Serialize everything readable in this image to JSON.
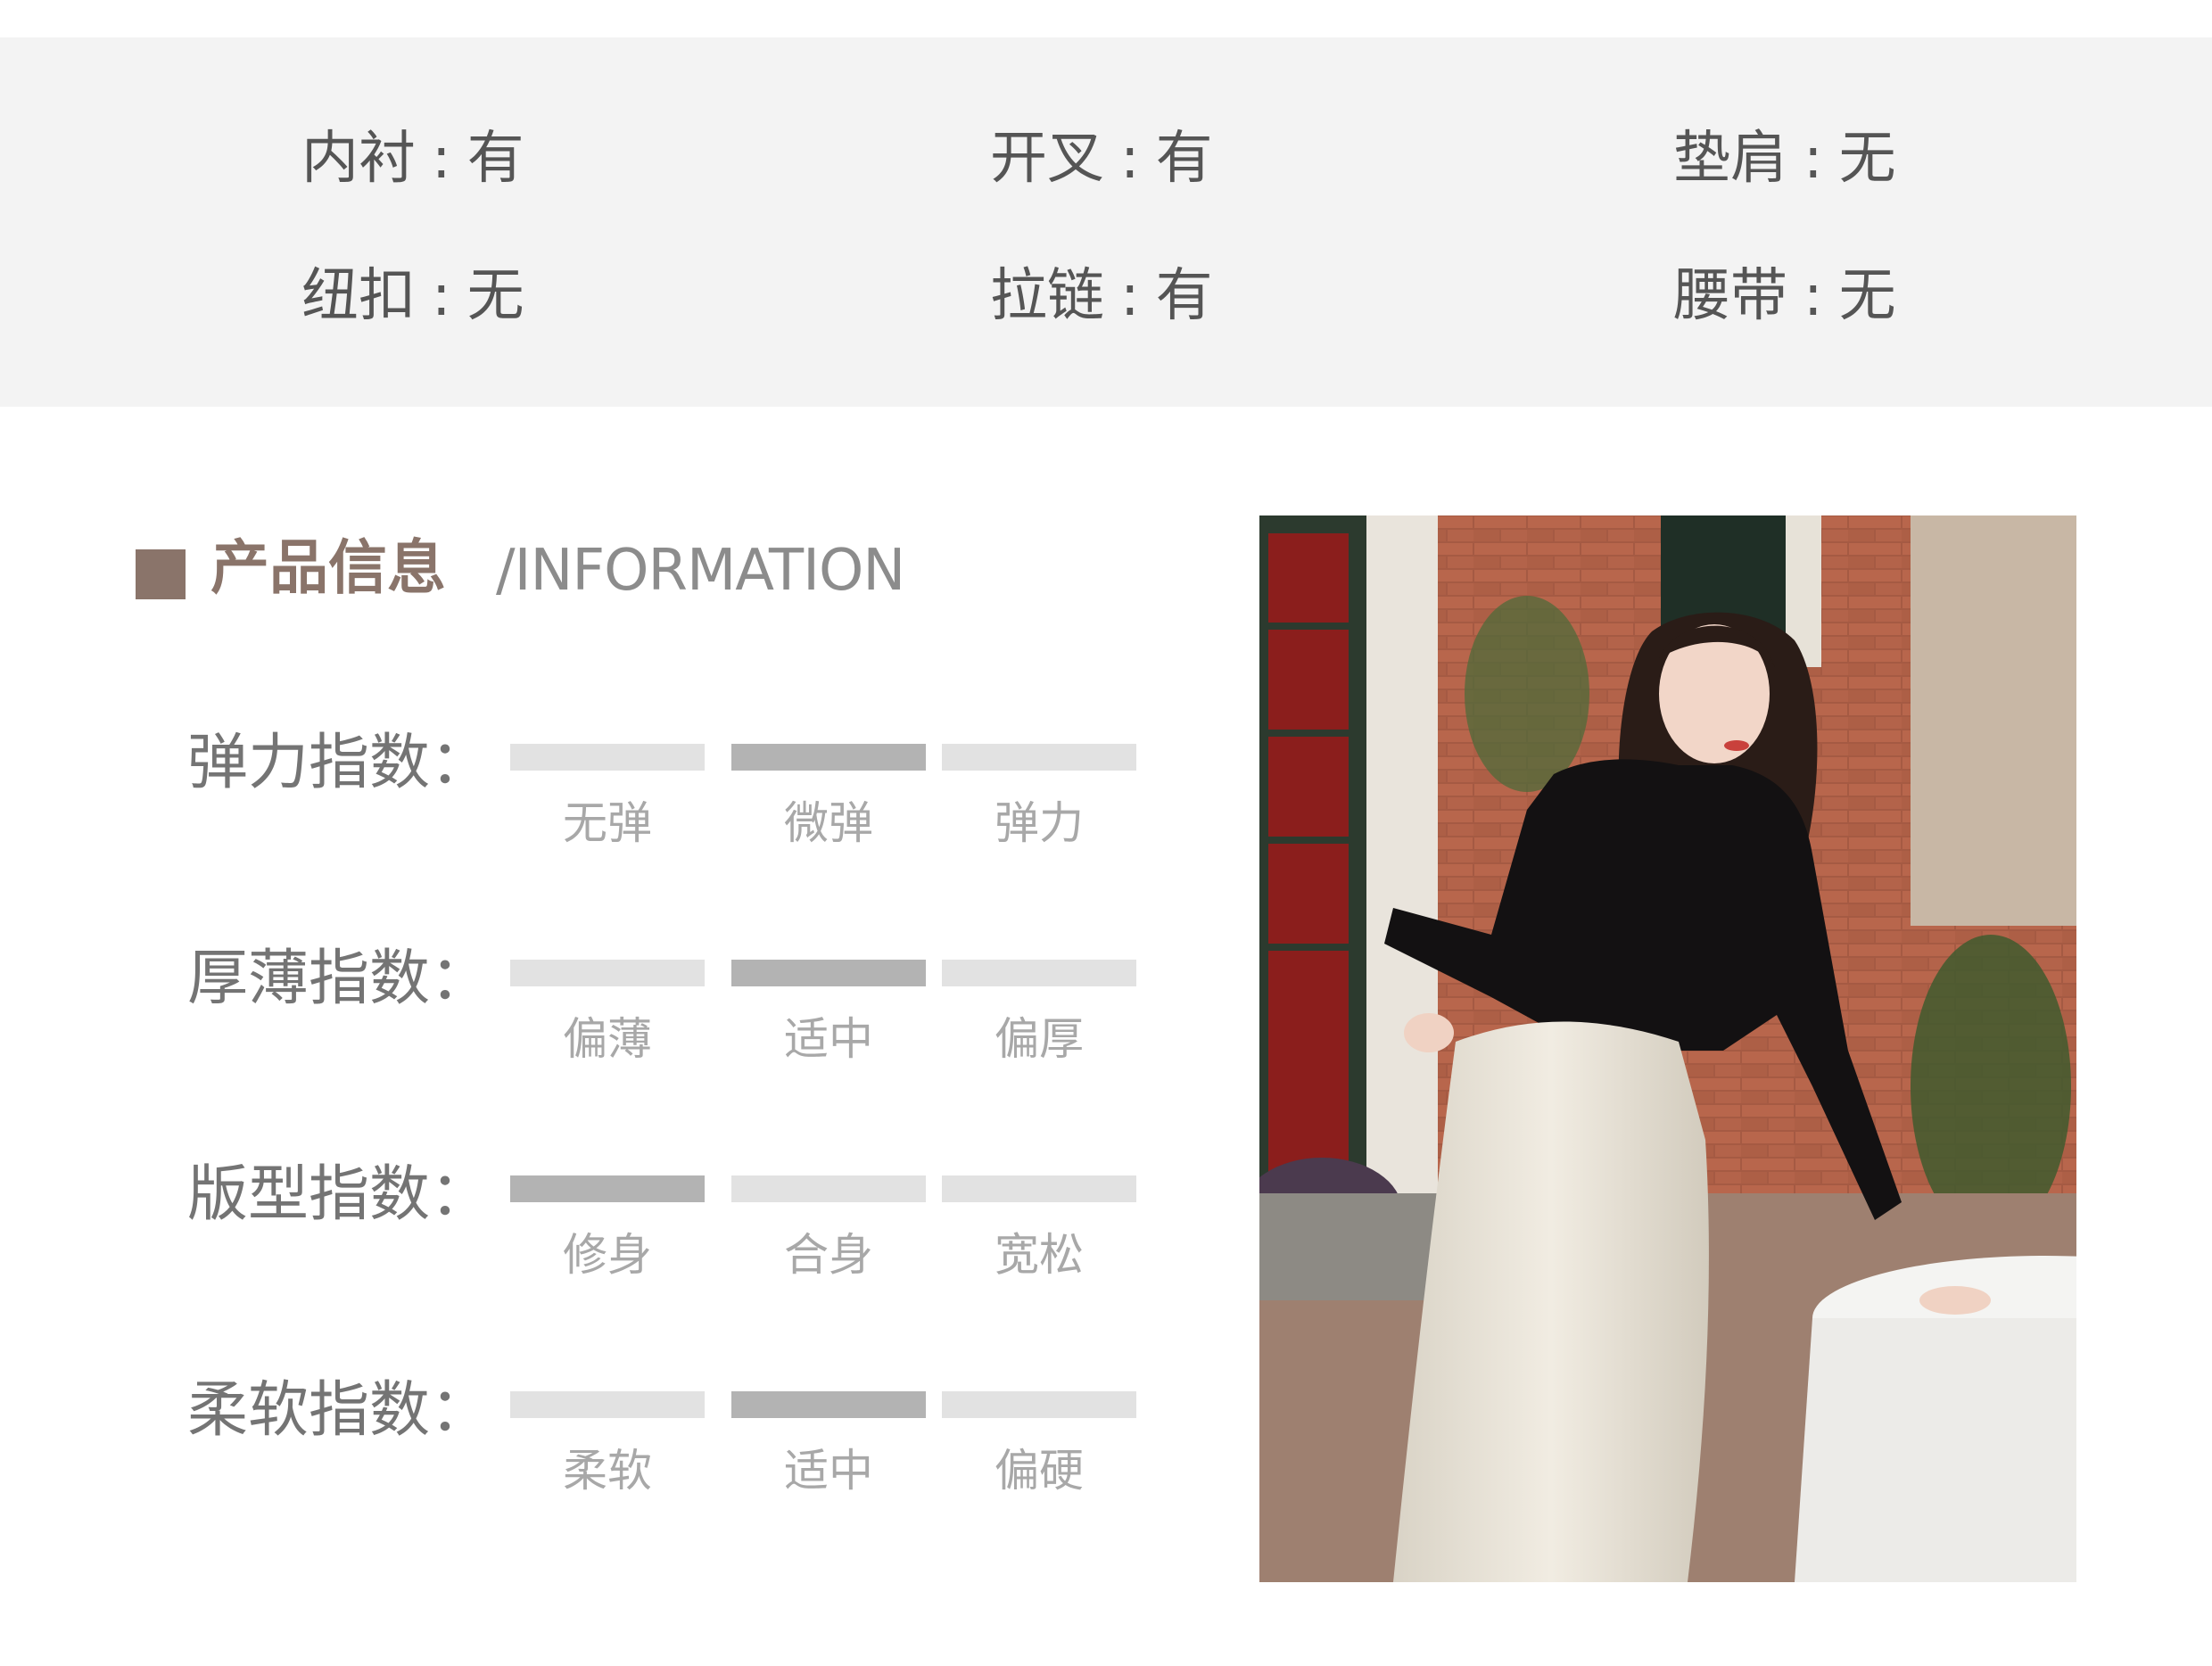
{
  "attributes": [
    {
      "name": "内衬",
      "value": "有"
    },
    {
      "name": "开叉",
      "value": "有"
    },
    {
      "name": "垫肩",
      "value": "无"
    },
    {
      "name": "纽扣",
      "value": "无"
    },
    {
      "name": "拉链",
      "value": "有"
    },
    {
      "name": "腰带",
      "value": "无"
    }
  ],
  "attr_separator": ":",
  "section": {
    "title": "产品信息",
    "subtitle": "/INFORMATION"
  },
  "indices": [
    {
      "label": "弹力指数：",
      "options": [
        "无弹",
        "微弹",
        "弹力"
      ],
      "selected": 1
    },
    {
      "label": "厚薄指数：",
      "options": [
        "偏薄",
        "适中",
        "偏厚"
      ],
      "selected": 1
    },
    {
      "label": "版型指数：",
      "options": [
        "修身",
        "合身",
        "宽松"
      ],
      "selected": 0
    },
    {
      "label": "柔软指数：",
      "options": [
        "柔软",
        "适中",
        "偏硬"
      ],
      "selected": 1
    }
  ],
  "colors": {
    "band": "#f3f3f3",
    "accent": "#8a746a",
    "bar_active": "#b3b3b3",
    "bar_inactive": "#e2e2e2"
  }
}
